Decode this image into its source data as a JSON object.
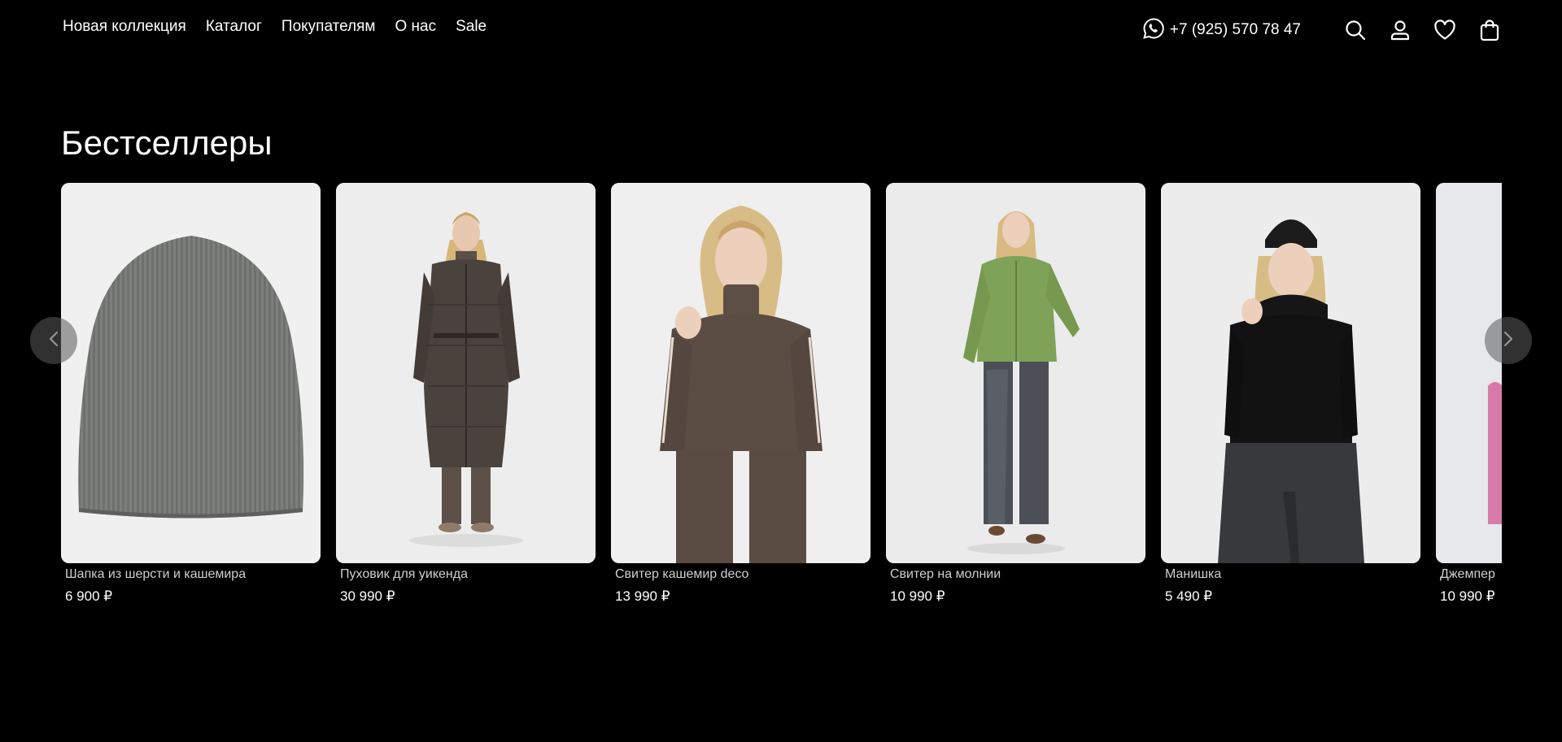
{
  "nav": {
    "items": [
      {
        "label": "Новая коллекция"
      },
      {
        "label": "Каталог"
      },
      {
        "label": "Покупателям"
      },
      {
        "label": "О нас"
      },
      {
        "label": "Sale"
      }
    ]
  },
  "header": {
    "phone": "+7 (925) 570 78 47",
    "icons": [
      "whatsapp-icon",
      "search-icon",
      "user-icon",
      "heart-icon",
      "bag-icon"
    ]
  },
  "bestsellers": {
    "title": "Бестселлеры",
    "products": [
      {
        "name": "Шапка из шерсти и кашемира",
        "price": "6 900 ₽"
      },
      {
        "name": "Пуховик для уикенда",
        "price": "30 990 ₽"
      },
      {
        "name": "Свитер кашемир deco",
        "price": "13 990 ₽"
      },
      {
        "name": "Свитер на молнии",
        "price": "10 990 ₽"
      },
      {
        "name": "Манишка",
        "price": "5 490 ₽"
      },
      {
        "name": "Джемпер",
        "price": "10 990 ₽"
      }
    ]
  },
  "colors": {
    "background": "#000000",
    "text": "#ffffff",
    "card_bg": "#efefef",
    "arrow_bg": "#5a5a5a"
  }
}
